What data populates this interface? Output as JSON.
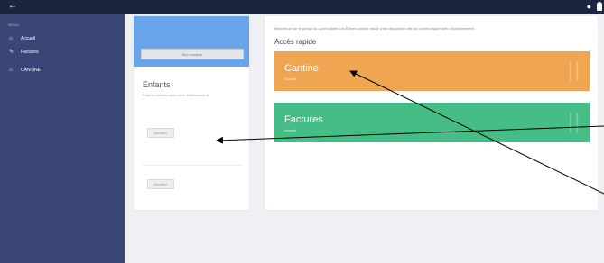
{
  "topbar": {
    "back_icon": "arrow-left-icon",
    "chat_icon": "chat-bubble-icon",
    "user_icon": "user-icon"
  },
  "sidebar": {
    "menu_title": "MENU",
    "items": [
      {
        "label": "Accueil",
        "icon": "home-icon"
      },
      {
        "label": "Factures",
        "icon": "pencil-icon"
      },
      {
        "label": "CANTINE",
        "icon": "home-icon"
      }
    ]
  },
  "left_card": {
    "banner_button": "Mon compte",
    "title": "Enfants",
    "subtitle": "Enfants inscrits dans notre établissement",
    "child_buttons": [
      "Modifier",
      "Modifier"
    ]
  },
  "right_card": {
    "welcome": "Bienvenue sur le portail du Lycée Albert Les Élèves cuisine mis à votre disposition afin de communiquer avec l'établissement.",
    "heading": "Accès rapide",
    "tiles": [
      {
        "title": "Cantine",
        "subtitle": "Accueil",
        "color": "#f0a552"
      },
      {
        "title": "Factures",
        "subtitle": "Accueil",
        "color": "#46bd86"
      }
    ]
  },
  "colors": {
    "topbar": "#1c2540",
    "sidebar": "#3a4675",
    "banner": "#6aa4ea"
  }
}
